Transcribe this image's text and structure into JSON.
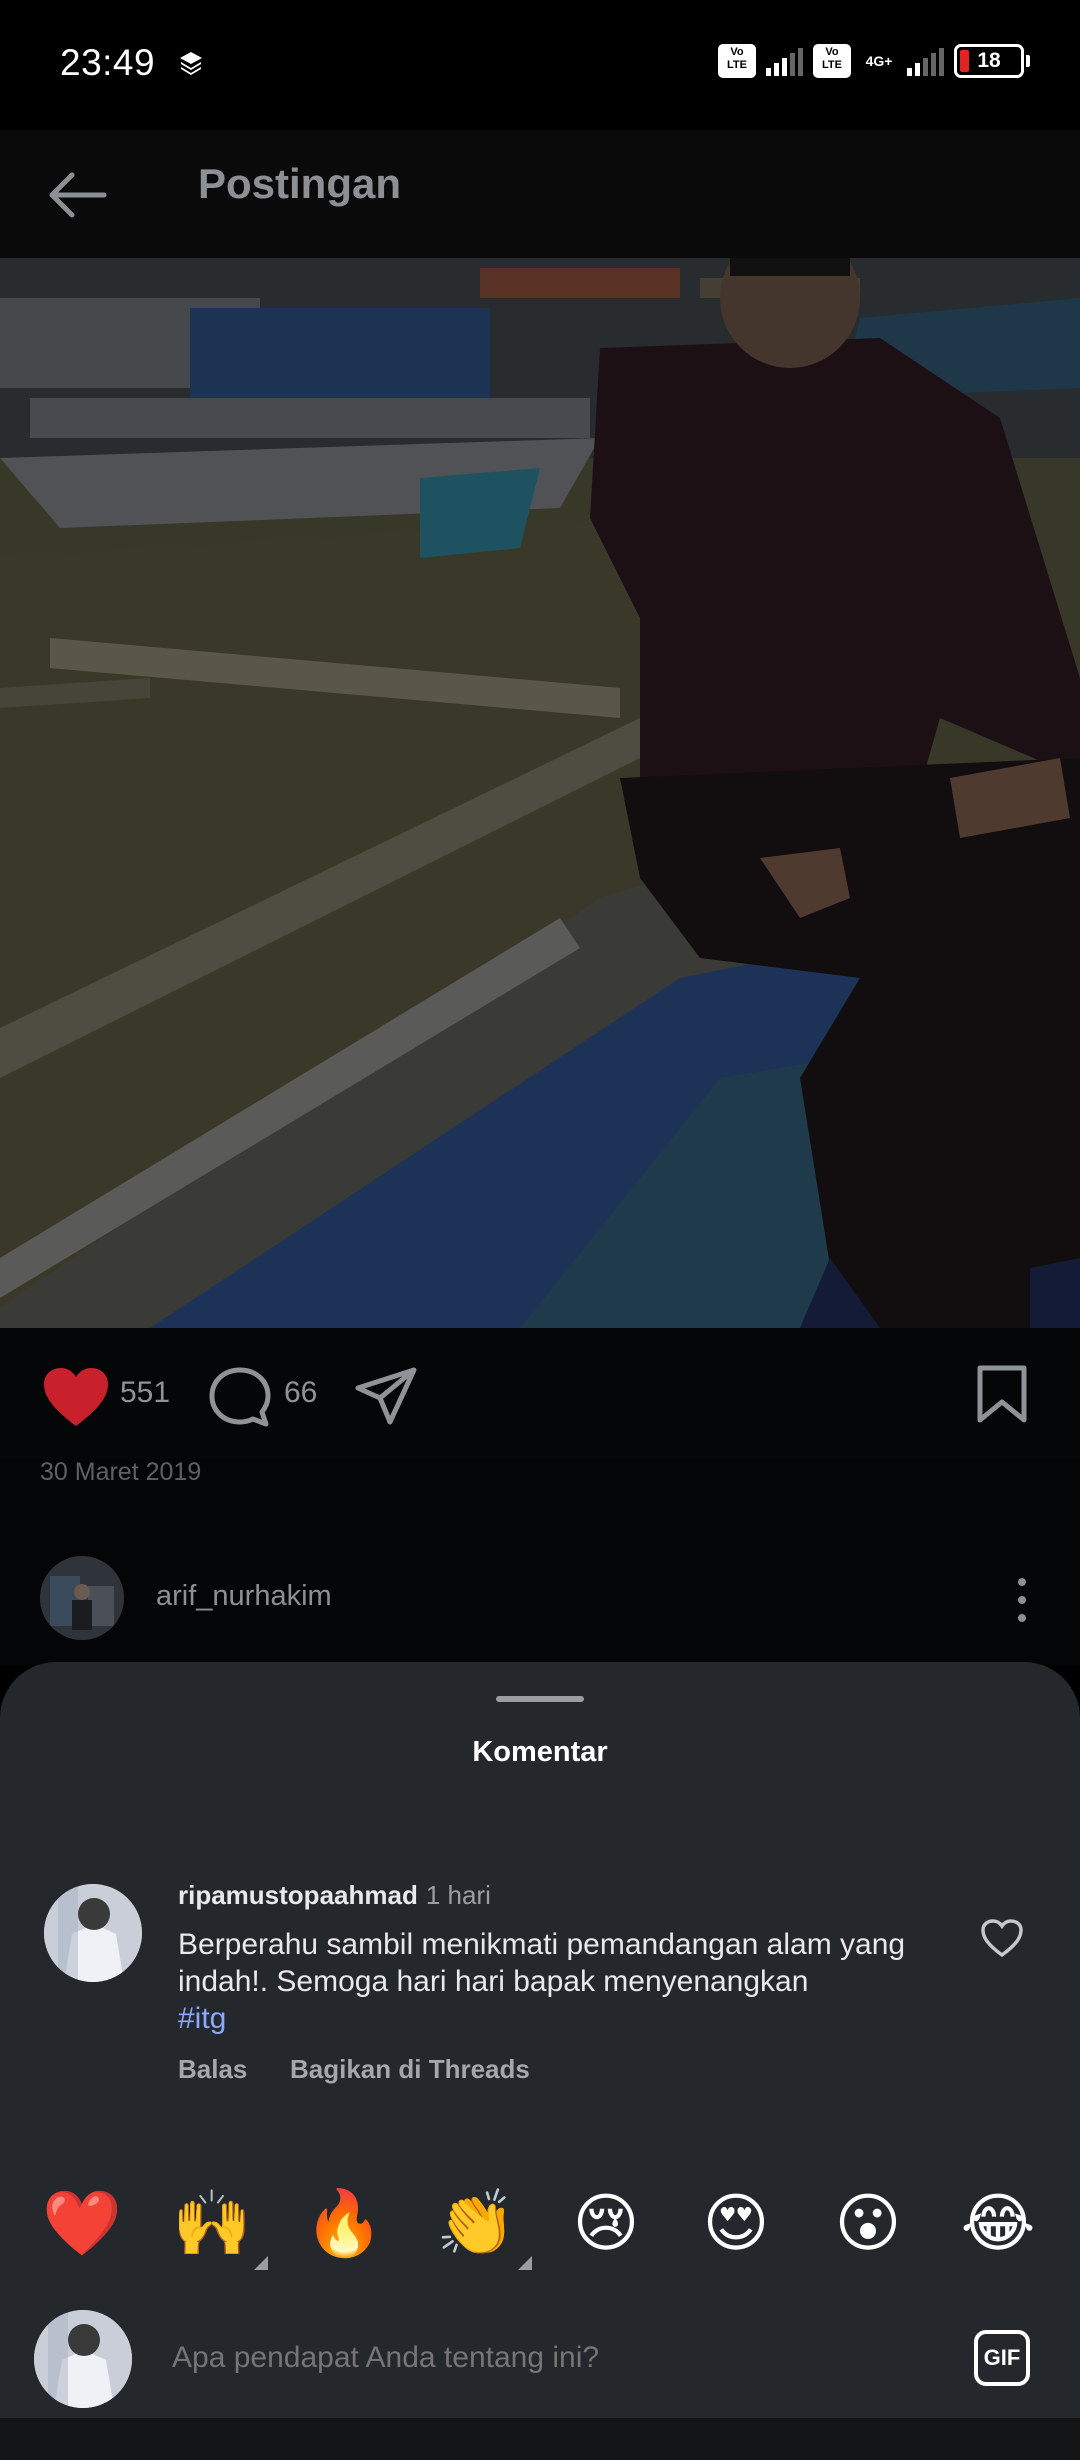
{
  "status_bar": {
    "time": "23:49",
    "network": "4G+",
    "battery": "18",
    "volte1": "Vo LTE",
    "volte2": "Vo LTE"
  },
  "header": {
    "title": "Postingan"
  },
  "post": {
    "likes": "551",
    "comments": "66",
    "date": "30 Maret 2019",
    "author": "arif_nurhakim"
  },
  "comments_sheet": {
    "title": "Komentar",
    "comment": {
      "username": "ripamustopaahmad",
      "time": "1 hari",
      "text": "Berperahu sambil menikmati pemandangan alam yang indah!. Semoga hari hari bapak menyenangkan",
      "hashtag": "#itg",
      "reply": "Balas",
      "share": "Bagikan di Threads"
    },
    "reactions": [
      "❤️",
      "🙌",
      "🔥",
      "👏",
      "😢",
      "😍",
      "😮",
      "😂"
    ],
    "input_placeholder": "Apa pendapat Anda tentang ini?",
    "gif_label": "GIF"
  },
  "colors": {
    "like_red": "#c8212b",
    "hashtag": "#8aa8ff",
    "sheet_bg": "#24272c"
  }
}
